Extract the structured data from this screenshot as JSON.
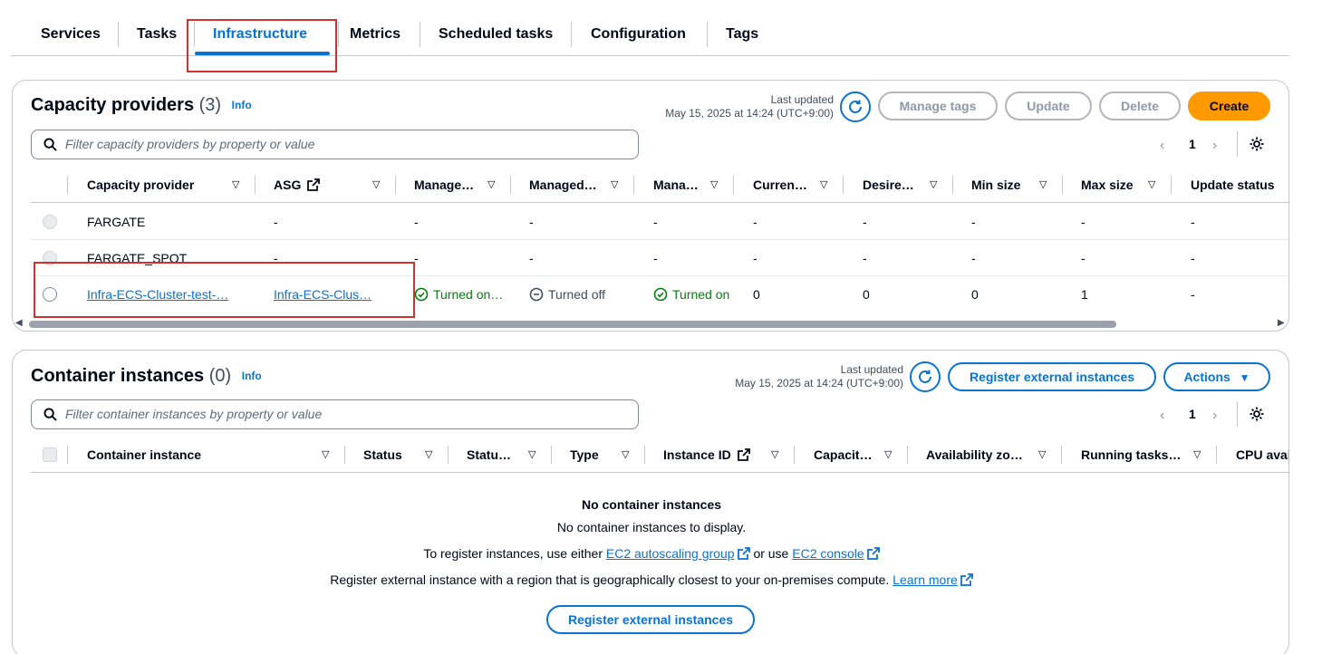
{
  "tabs": [
    "Services",
    "Tasks",
    "Infrastructure",
    "Metrics",
    "Scheduled tasks",
    "Configuration",
    "Tags"
  ],
  "active_tab": "Infrastructure",
  "capacity": {
    "title": "Capacity providers",
    "count": "(3)",
    "info": "Info",
    "last_updated_label": "Last updated",
    "last_updated_value": "May 15, 2025 at 14:24 (UTC+9:00)",
    "buttons": {
      "manage_tags": "Manage tags",
      "update": "Update",
      "delete": "Delete",
      "create": "Create"
    },
    "filter_placeholder": "Filter capacity providers by property or value",
    "page": "1",
    "columns": [
      "Capacity provider",
      "ASG",
      "Manage…",
      "Managed…",
      "Mana…",
      "Curren…",
      "Desire…",
      "Min size",
      "Max size",
      "Update status"
    ],
    "rows": [
      {
        "name": "FARGATE",
        "asg": "-",
        "c3": "-",
        "c4": "-",
        "c5": "-",
        "c6": "-",
        "c7": "-",
        "c8": "-",
        "c9": "-",
        "c10": "-"
      },
      {
        "name": "FARGATE_SPOT",
        "asg": "-",
        "c3": "-",
        "c4": "-",
        "c5": "-",
        "c6": "-",
        "c7": "-",
        "c8": "-",
        "c9": "-",
        "c10": "-"
      },
      {
        "name": "Infra-ECS-Cluster-test-…",
        "asg": "Infra-ECS-Clus…",
        "c3": "Turned on…",
        "c4": "Turned off",
        "c5": "Turned on",
        "c6": "0",
        "c7": "0",
        "c8": "0",
        "c9": "1",
        "c10": "-"
      }
    ]
  },
  "container": {
    "title": "Container instances",
    "count": "(0)",
    "info": "Info",
    "last_updated_label": "Last updated",
    "last_updated_value": "May 15, 2025 at 14:24 (UTC+9:00)",
    "buttons": {
      "register": "Register external instances",
      "actions": "Actions"
    },
    "filter_placeholder": "Filter container instances by property or value",
    "page": "1",
    "columns": [
      "Container instance",
      "Status",
      "Statu…",
      "Type",
      "Instance ID",
      "Capacit…",
      "Availability zo…",
      "Running tasks…",
      "CPU avai"
    ],
    "empty": {
      "heading": "No container instances",
      "subheading": "No container instances to display.",
      "line1_prefix": "To register instances, use either",
      "line1_link1": "EC2 autoscaling group",
      "line1_middle": "or use",
      "line1_link2": "EC2 console",
      "line2_prefix": "Register external instance with a region that is geographically closest to your on-premises compute.",
      "line2_link": "Learn more",
      "button": "Register external instances"
    }
  },
  "colors": {
    "accent": "#0972d3",
    "primary_button": "#ff9900",
    "success": "#037f0c",
    "highlight_box": "#d0312d"
  }
}
